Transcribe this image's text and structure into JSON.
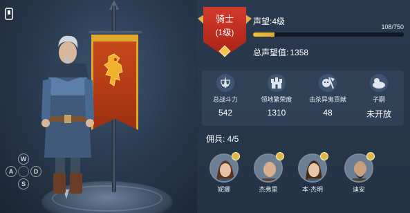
{
  "character": {
    "rank_name": "骑士",
    "rank_level": "(1级)"
  },
  "prestige": {
    "label": "声望:4级",
    "current": 108,
    "max": 750,
    "progress_text": "108/750",
    "total_label": "总声望值:",
    "total_value": "1358"
  },
  "stats": [
    {
      "icon": "sword-shield-icon",
      "label": "总战斗力",
      "value": "542"
    },
    {
      "icon": "castle-icon",
      "label": "领地繁荣度",
      "value": "1310"
    },
    {
      "icon": "demon-axe-icon",
      "label": "击杀异鬼贡献",
      "value": "48"
    },
    {
      "icon": "baby-icon",
      "label": "子嗣",
      "value": "未开放"
    }
  ],
  "mercenaries": {
    "label": "佣兵: 4/5",
    "items": [
      {
        "name": "妮娜"
      },
      {
        "name": "杰弗里"
      },
      {
        "name": "本·杰明"
      },
      {
        "name": "迪安"
      }
    ]
  },
  "controls": {
    "w": "W",
    "a": "A",
    "s": "S",
    "d": "D"
  },
  "colors": {
    "accent_gold": "#e3a92a",
    "rank_red": "#c02c1e",
    "banner_red": "#b23a14"
  }
}
